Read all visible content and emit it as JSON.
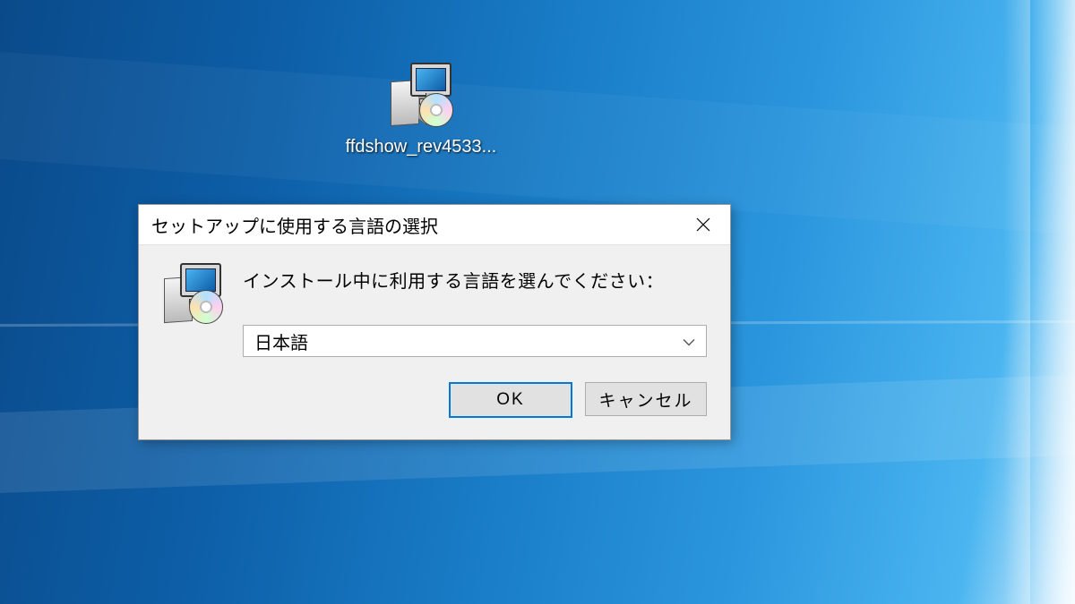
{
  "desktop": {
    "icon_label": "ffdshow_rev4533..."
  },
  "dialog": {
    "title": "セットアップに使用する言語の選択",
    "instruction": "インストール中に利用する言語を選んでください：",
    "selected_language": "日本語",
    "ok_label": "OK",
    "cancel_label": "キャンセル"
  }
}
